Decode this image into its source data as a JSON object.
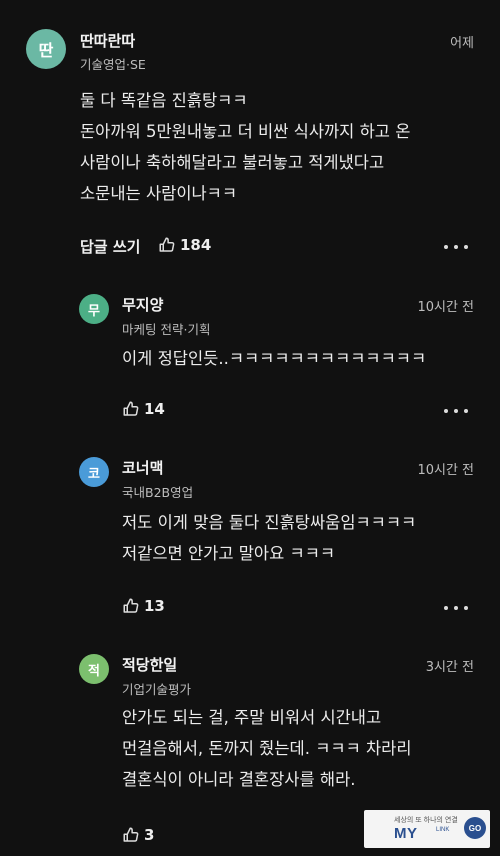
{
  "comments": [
    {
      "avatar": "딴",
      "avatar_color": "#6bb8a4",
      "name": "딴따란따",
      "dept": "기술영업·SE",
      "time": "어제",
      "lines": [
        "둘 다 똑같음 진흙탕ㅋㅋ",
        "돈아까워 5만원내놓고 더 비싼 식사까지 하고 온",
        "사람이나 축하해달라고 불러놓고 적게냈다고",
        "소문내는 사람이나ㅋㅋ"
      ],
      "reply_label": "답글 쓰기",
      "likes": "184"
    }
  ],
  "replies": [
    {
      "avatar": "무",
      "avatar_color": "#4caf86",
      "name": "무지양",
      "dept": "마케팅 전략·기획",
      "time": "10시간 전",
      "lines": [
        "이게 정답인듯..ㅋㅋㅋㅋㅋㅋㅋㅋㅋㅋㅋㅋㅋ"
      ],
      "likes": "14"
    },
    {
      "avatar": "코",
      "avatar_color": "#4a9bd8",
      "name": "코너맥",
      "dept": "국내B2B영업",
      "time": "10시간 전",
      "lines": [
        "저도 이게 맞음 둘다 진흙탕싸움임ㅋㅋㅋㅋ",
        "저같으면 안가고 말아요 ㅋㅋㅋ"
      ],
      "likes": "13"
    },
    {
      "avatar": "적",
      "avatar_color": "#7cbf6e",
      "name": "적당한일",
      "dept": "기업기술평가",
      "time": "3시간 전",
      "lines": [
        "안가도 되는 걸, 주말 비워서 시간내고",
        "먼걸음해서, 돈까지 줬는데. ㅋㅋㅋ 차라리",
        "결혼식이 아니라 결혼장사를 해라."
      ],
      "likes": "3"
    }
  ],
  "watermark": {
    "top": "세상의 또 하나의 연결",
    "main": "MY",
    "sub": "LINK",
    "go": "GO"
  }
}
